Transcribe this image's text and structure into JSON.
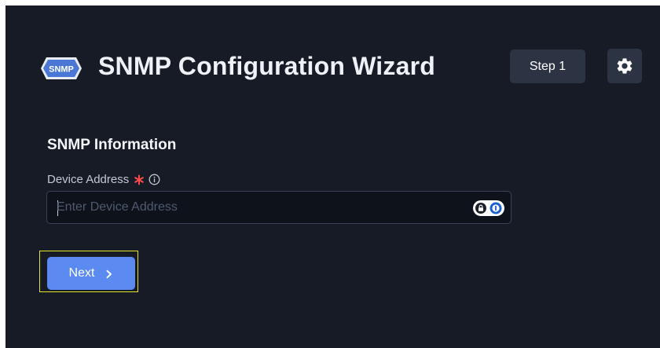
{
  "header": {
    "logo_text": "SNMP",
    "title": "SNMP Configuration Wizard",
    "step_label": "Step 1",
    "settings_icon": "gear-icon"
  },
  "form": {
    "section_title": "SNMP Information",
    "device_address": {
      "label": "Device Address",
      "required_icon": "asterisk-icon",
      "info_icon": "info-icon",
      "value": "",
      "placeholder": "Enter Device Address",
      "extension_icons": [
        "lock-icon",
        "password-manager-icon"
      ]
    }
  },
  "actions": {
    "next_label": "Next",
    "next_icon": "chevron-right-icon"
  },
  "colors": {
    "background": "#161b26",
    "accent": "#5b8af0",
    "required": "#ff4a4a",
    "highlight": "#e3e62a"
  }
}
